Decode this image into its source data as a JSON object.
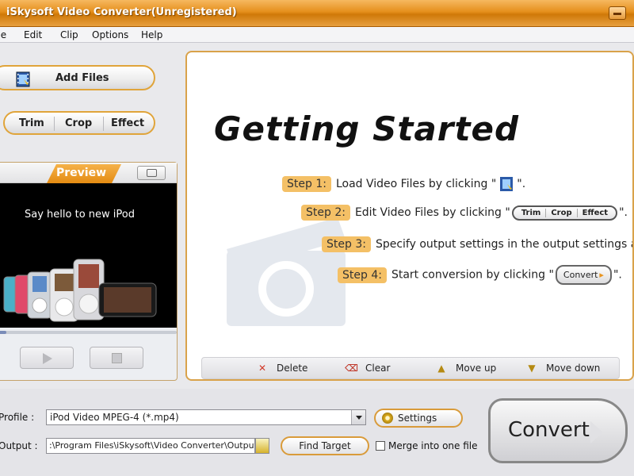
{
  "window": {
    "title": "iSkysoft Video Converter(Unregistered)"
  },
  "menu": [
    {
      "label": "File"
    },
    {
      "label": "Edit"
    },
    {
      "label": "Clip"
    },
    {
      "label": "Options"
    },
    {
      "label": "Help"
    }
  ],
  "left": {
    "add_files_label": "Add  Files",
    "edit_buttons": [
      "Trim",
      "Crop",
      "Effect"
    ],
    "preview": {
      "title": "Preview",
      "screen_text": "Say hello to new iPod",
      "seek_progress": 0.05
    }
  },
  "getting_started": {
    "title": "Getting Started",
    "steps": [
      {
        "tag": "Step 1:",
        "text": "Load Video Files by clicking \"",
        "end": "\"."
      },
      {
        "tag": "Step 2:",
        "text": "Edit Video Files by clicking \"",
        "end": "\".",
        "inline": [
          "Trim",
          "Crop",
          "Effect"
        ]
      },
      {
        "tag": "Step 3:",
        "text": "Specify output settings in the output settings area."
      },
      {
        "tag": "Step 4:",
        "text": "Start conversion by clicking \"",
        "end": "\".",
        "inline_button": "Convert"
      }
    ],
    "actions": [
      {
        "label": "Delete",
        "icon": "delete-icon"
      },
      {
        "label": "Clear",
        "icon": "clear-icon"
      },
      {
        "label": "Move up",
        "icon": "move-up-icon"
      },
      {
        "label": "Move down",
        "icon": "move-down-icon"
      }
    ]
  },
  "bottom": {
    "profile_label": "Profile :",
    "profile_value": "iPod Video MPEG-4 (*.mp4)",
    "settings_label": "Settings",
    "output_label": "Output :",
    "output_value": ":\\Program Files\\iSkysoft\\Video Converter\\Output\\",
    "find_target_label": "Find Target",
    "merge_label": "Merge into one file",
    "merge_checked": false,
    "convert_label": "Convert"
  },
  "colors": {
    "accent_orange": "#e58f1c",
    "step_tag": "#f4c066",
    "panel_border": "#d9a24a"
  }
}
